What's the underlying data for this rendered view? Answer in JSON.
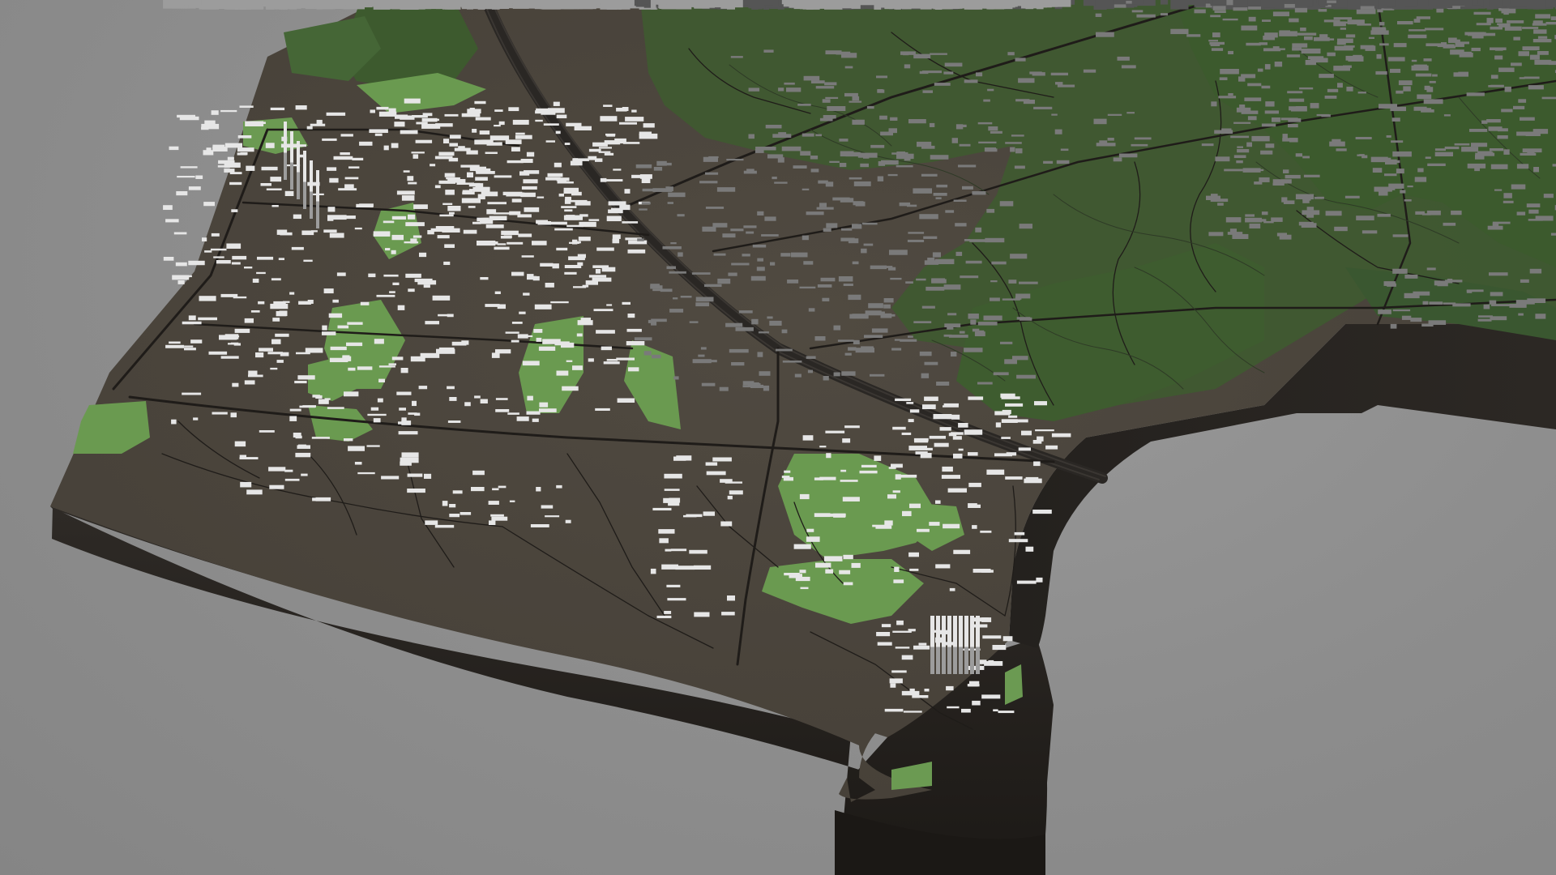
{
  "scene": {
    "kind": "3d-city-terrain-model",
    "colors": {
      "background": "#8c8c8c",
      "terrain_top": "#4a443c",
      "terrain_side": "#2a2622",
      "terrain_side_dark": "#201d1a",
      "forest": "#3f5a30",
      "forest_dark": "#344d28",
      "park": "#6a9a50",
      "road": "#1e1b18",
      "rail": "#2f2c29",
      "building_top": "#e6e6e6",
      "building_side": "#9c9c9c",
      "building_dark_top": "#7a7a7a",
      "building_dark_side": "#555555"
    }
  }
}
